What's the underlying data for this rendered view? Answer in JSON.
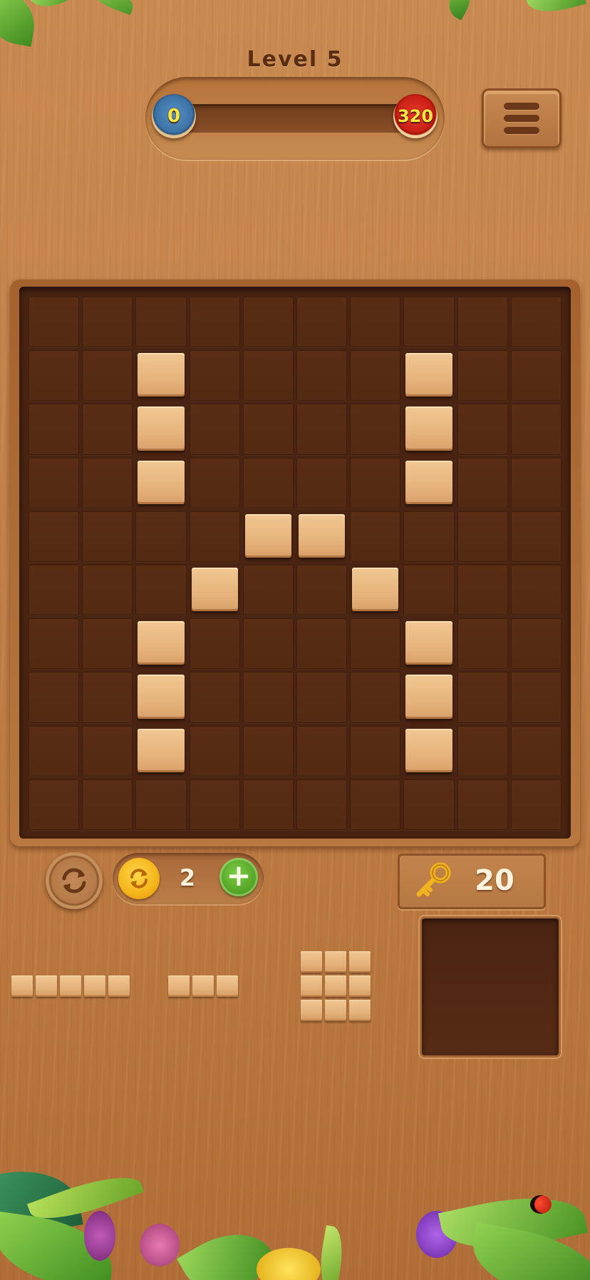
{
  "header": {
    "level_title": "Level 5",
    "score_current": "0",
    "score_target": "320",
    "progress_fraction": 0
  },
  "board": {
    "rows": 10,
    "cols": 10,
    "filled_cells": [
      [
        1,
        2
      ],
      [
        1,
        7
      ],
      [
        2,
        2
      ],
      [
        2,
        7
      ],
      [
        3,
        2
      ],
      [
        3,
        7
      ],
      [
        4,
        4
      ],
      [
        4,
        5
      ],
      [
        5,
        3
      ],
      [
        5,
        6
      ],
      [
        6,
        2
      ],
      [
        6,
        7
      ],
      [
        7,
        2
      ],
      [
        7,
        7
      ],
      [
        8,
        2
      ],
      [
        8,
        7
      ]
    ]
  },
  "controls": {
    "coin_count": "2",
    "add_label": "+",
    "key_count": "20"
  },
  "pieces": [
    {
      "name": "piece-line-5",
      "shape": "1x5"
    },
    {
      "name": "piece-line-3",
      "shape": "1x3"
    },
    {
      "name": "piece-square-3x3",
      "shape": "3x3"
    }
  ],
  "colors": {
    "wood_background": "#c2814a",
    "board_cell": "#552a14",
    "block": "#e6b47c",
    "score_start_badge": "#3c72a6",
    "score_target_badge": "#c81f16",
    "coin": "#f5b41a",
    "add_button": "#4f9f22"
  },
  "icons": {
    "rotate": "rotate-arrows-icon",
    "coin": "coin-refresh-icon",
    "add": "plus-icon",
    "key": "key-icon",
    "menu": "hamburger-menu-icon"
  }
}
